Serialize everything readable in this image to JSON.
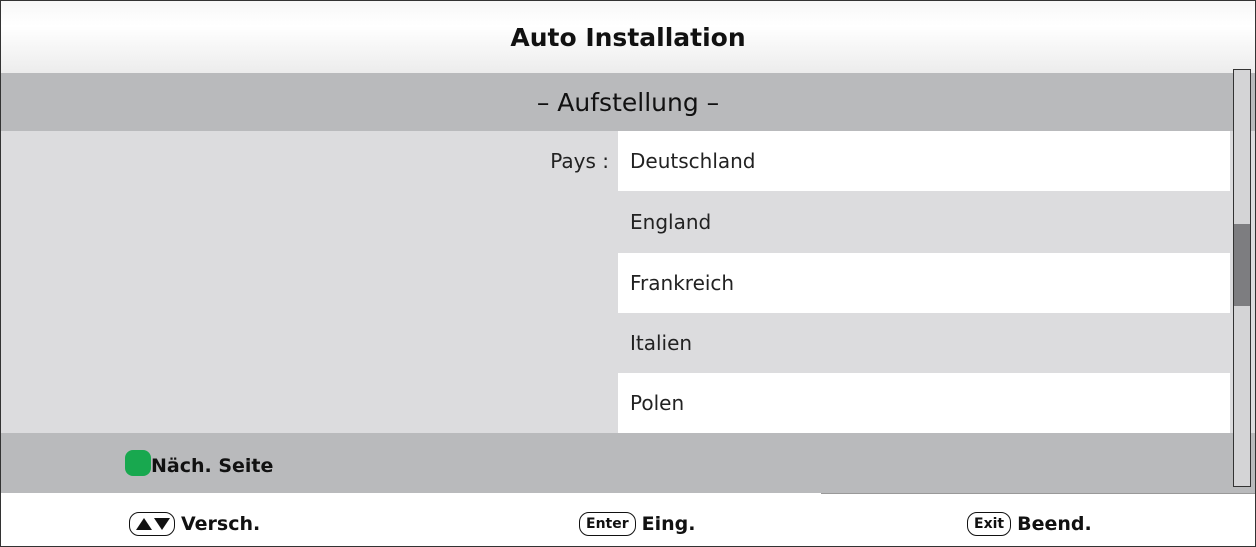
{
  "title": "Auto Installation",
  "subtitle": "– Aufstellung –",
  "field": {
    "label": "Pays :",
    "options": [
      {
        "label": "Deutschland",
        "selected": true
      },
      {
        "label": "England",
        "selected": false
      },
      {
        "label": "Frankreich",
        "selected": false
      },
      {
        "label": "Italien",
        "selected": false
      },
      {
        "label": "Polen",
        "selected": false
      }
    ]
  },
  "next_page": {
    "label": "Näch. Seite",
    "key_color": "#18a84f"
  },
  "footer": {
    "move": {
      "label": "Versch.",
      "icon": "up-down-arrows-icon"
    },
    "enter": {
      "key": "Enter",
      "label": "Eing."
    },
    "exit": {
      "key": "Exit",
      "label": "Beend."
    }
  }
}
